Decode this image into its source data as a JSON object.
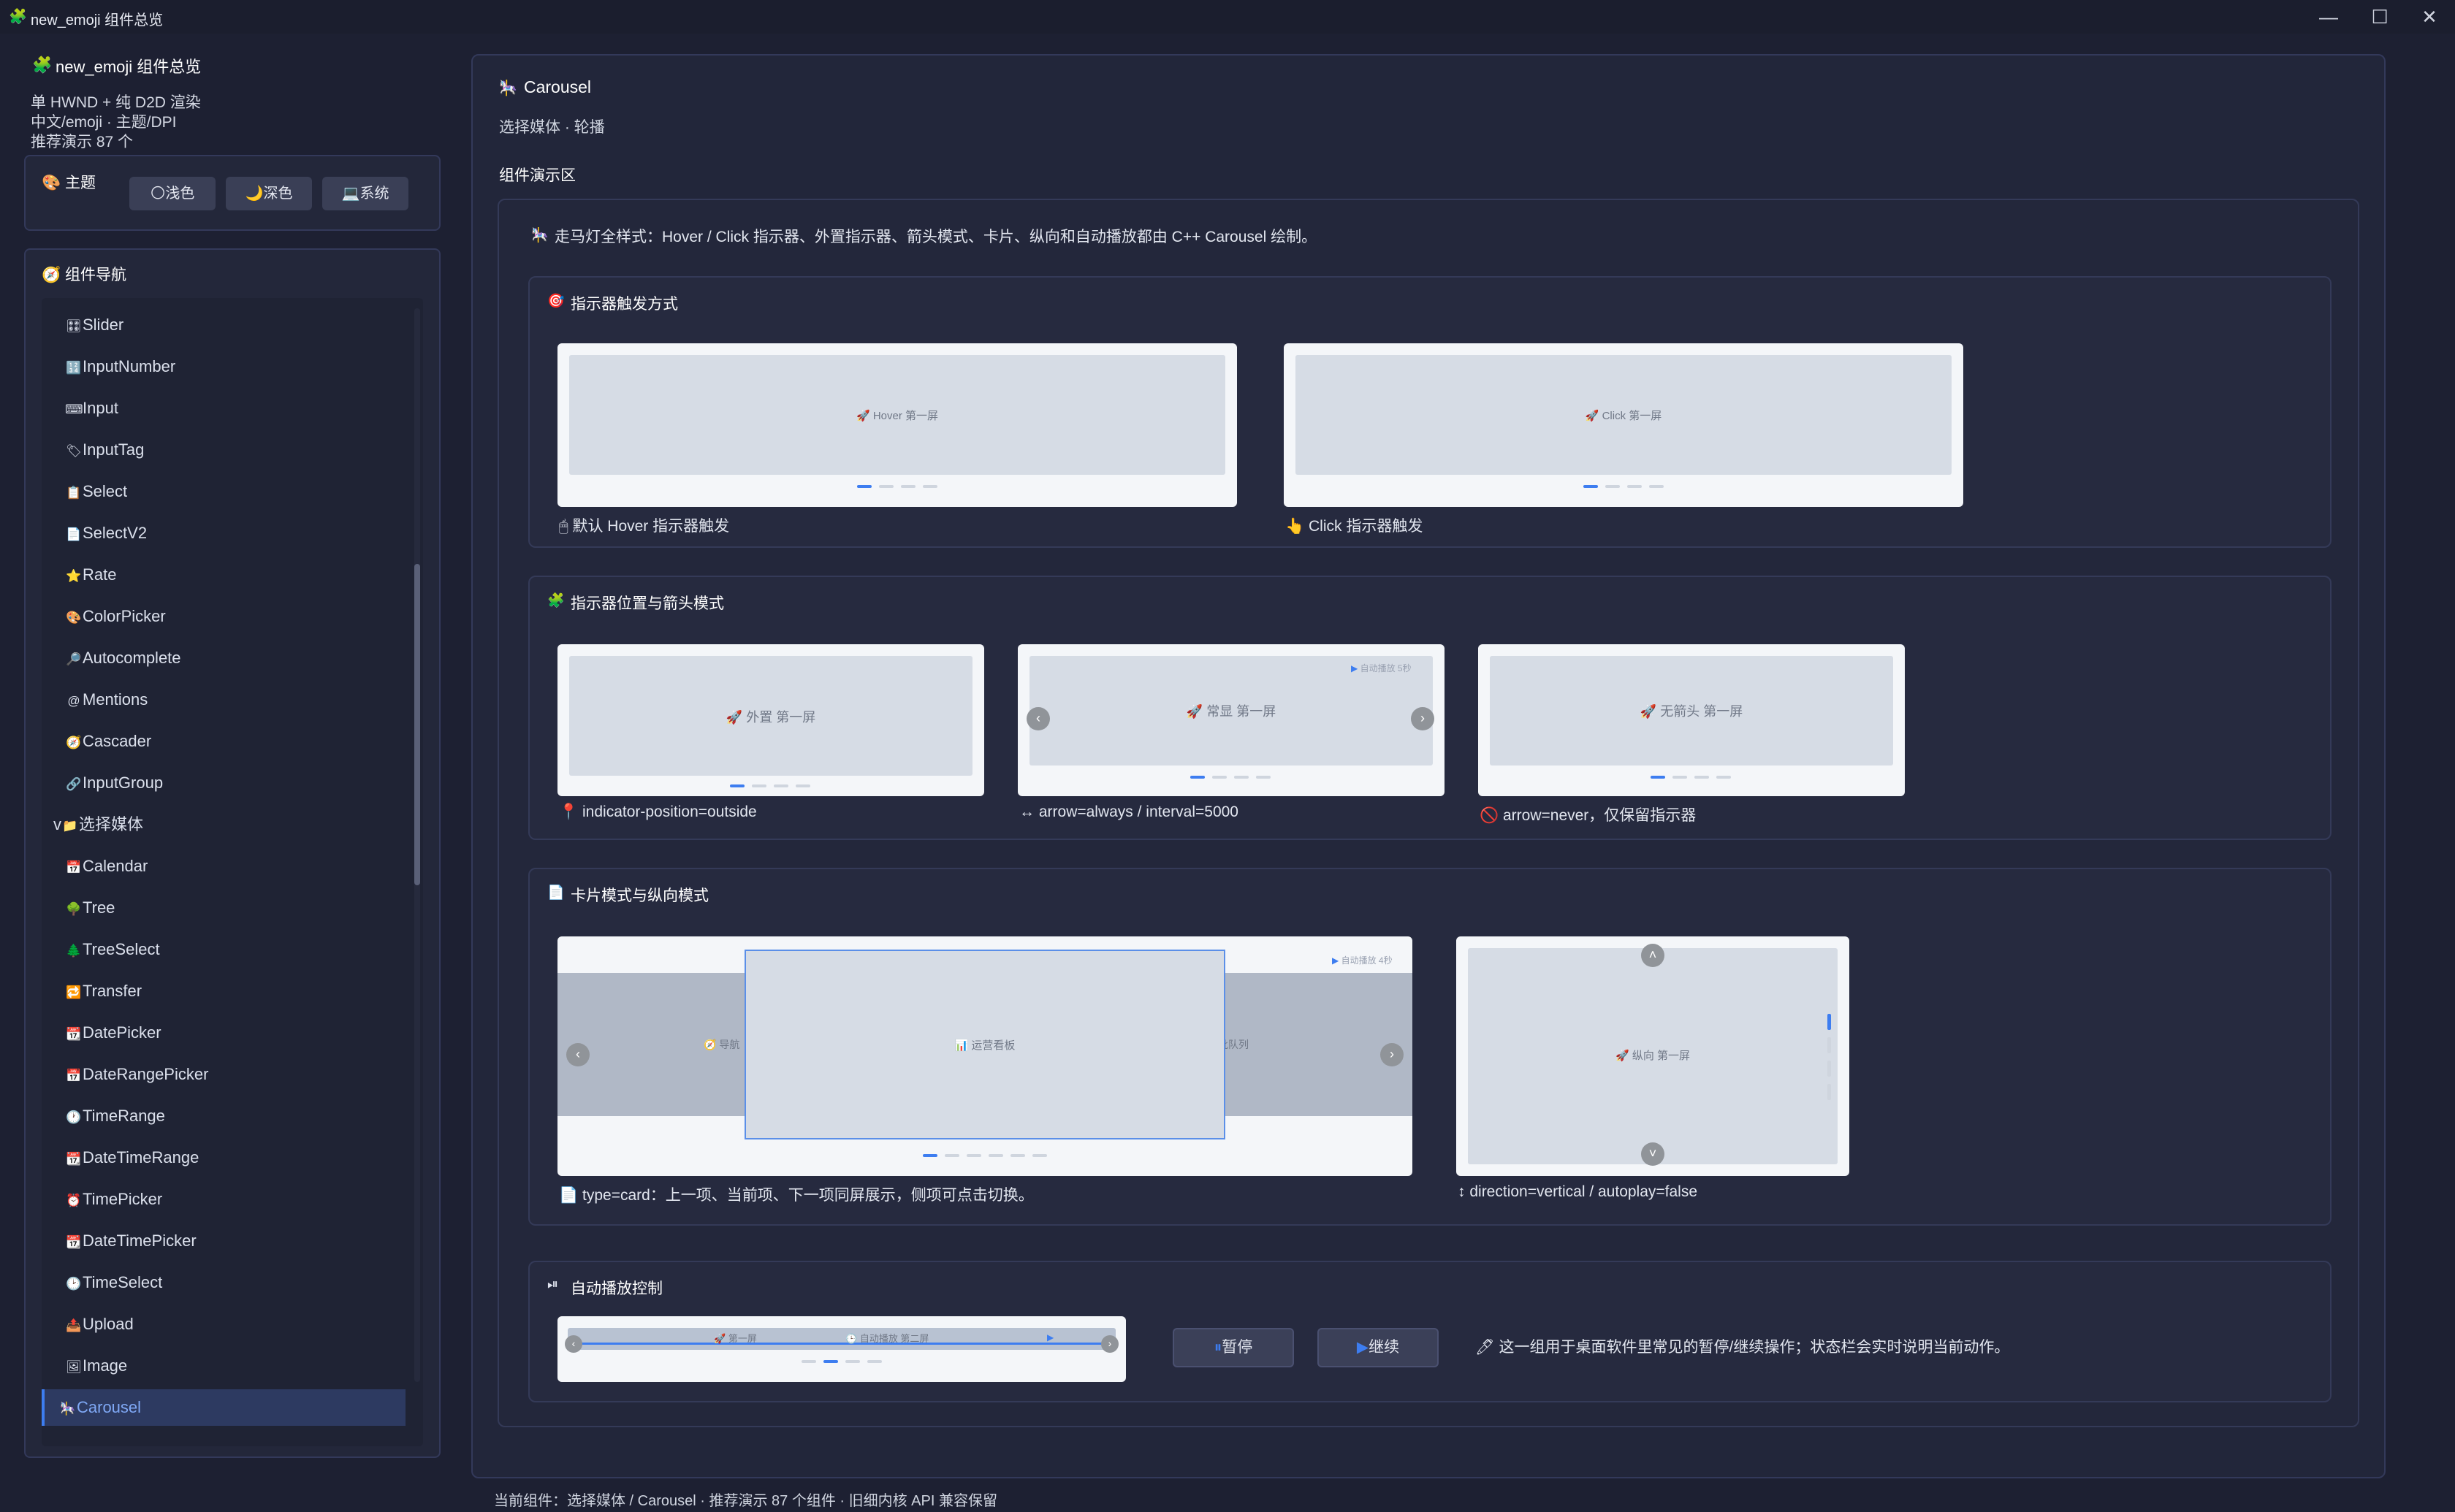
{
  "window": {
    "title": "new_emoji 组件总览",
    "controls": {
      "minimize": "—",
      "maximize": "☐",
      "close": "✕"
    }
  },
  "sidebar": {
    "app_title": "new_emoji 组件总览",
    "subtitles": [
      "单 HWND + 纯 D2D 渲染",
      "中文/emoji · 主题/DPI",
      "推荐演示 87 个"
    ],
    "theme": {
      "label": "主题",
      "buttons": [
        {
          "label": "浅色",
          "icon": "🌕"
        },
        {
          "label": "深色",
          "icon": "🌙"
        },
        {
          "label": "系统",
          "icon": "💻"
        }
      ]
    },
    "nav": {
      "title": "组件导航",
      "items": [
        {
          "label": "Slider",
          "icon": "🎛"
        },
        {
          "label": "InputNumber",
          "icon": "🔢"
        },
        {
          "label": "Input",
          "icon": "⌨"
        },
        {
          "label": "InputTag",
          "icon": "🏷"
        },
        {
          "label": "Select",
          "icon": "📋"
        },
        {
          "label": "SelectV2",
          "icon": "📄"
        },
        {
          "label": "Rate",
          "icon": "⭐"
        },
        {
          "label": "ColorPicker",
          "icon": "🎨"
        },
        {
          "label": "Autocomplete",
          "icon": "🔎"
        },
        {
          "label": "Mentions",
          "icon": "@"
        },
        {
          "label": "Cascader",
          "icon": "🧭"
        },
        {
          "label": "InputGroup",
          "icon": "🔗"
        },
        {
          "label": "选择媒体",
          "icon": "📁",
          "prefix": "v"
        },
        {
          "label": "Calendar",
          "icon": "📅"
        },
        {
          "label": "Tree",
          "icon": "🌳"
        },
        {
          "label": "TreeSelect",
          "icon": "🌲"
        },
        {
          "label": "Transfer",
          "icon": "🔁"
        },
        {
          "label": "DatePicker",
          "icon": "📆"
        },
        {
          "label": "DateRangePicker",
          "icon": "📅"
        },
        {
          "label": "TimeRange",
          "icon": "🕐"
        },
        {
          "label": "DateTimeRange",
          "icon": "📆"
        },
        {
          "label": "TimePicker",
          "icon": "⏰"
        },
        {
          "label": "DateTimePicker",
          "icon": "📆"
        },
        {
          "label": "TimeSelect",
          "icon": "🕑"
        },
        {
          "label": "Upload",
          "icon": "📤"
        },
        {
          "label": "Image",
          "icon": "🖼"
        },
        {
          "label": "Carousel",
          "icon": "🎠",
          "active": true
        }
      ]
    }
  },
  "main": {
    "title": "Carousel",
    "title_icon": "🎠",
    "subtitle": "选择媒体 · 轮播",
    "demo_label": "组件演示区",
    "intro": "走马灯全样式：Hover / Click 指示器、外置指示器、箭头模式、卡片、纵向和自动播放都由 C++ Carousel 绘制。",
    "intro_icon": "🎠",
    "sections": {
      "trigger": {
        "title": "指示器触发方式",
        "icon": "🎯",
        "demos": [
          {
            "slide": "Hover 第一屏",
            "caption": "默认 Hover 指示器触发",
            "caption_icon": "🖱"
          },
          {
            "slide": "Click 第一屏",
            "caption": "Click 指示器触发",
            "caption_icon": "👆"
          }
        ]
      },
      "position": {
        "title": "指示器位置与箭头模式",
        "icon": "🧩",
        "demos": [
          {
            "slide": "外置 第一屏",
            "caption": "indicator-position=outside",
            "caption_icon": "📍"
          },
          {
            "slide": "常显 第一屏",
            "caption": "arrow=always / interval=5000",
            "caption_icon": "↔",
            "badge": "自动播放 5秒"
          },
          {
            "slide": "无箭头 第一屏",
            "caption": "arrow=never，仅保留指示器",
            "caption_icon": "🚫"
          }
        ]
      },
      "card": {
        "title": "卡片模式与纵向模式",
        "icon": "📄",
        "card_demo": {
          "center": "运营看板",
          "left": "导航",
          "right": "审批队列",
          "badge": "自动播放 4秒",
          "caption": "type=card：上一项、当前项、下一项同屏展示，侧项可点击切换。",
          "caption_icon": "📄"
        },
        "vertical_demo": {
          "slide": "纵向 第一屏",
          "caption": "direction=vertical / autoplay=false",
          "caption_icon": "↕"
        }
      },
      "autoplay": {
        "title": "自动播放控制",
        "icon": "⏯",
        "strip_left": "第一屏",
        "strip_center": "自动播放 第二屏",
        "pause_label": "暂停",
        "resume_label": "继续",
        "note": "这一组用于桌面软件里常见的暂停/继续操作；状态栏会实时说明当前动作。",
        "note_icon": "🖊"
      }
    }
  },
  "status_bar": "当前组件：选择媒体 / Carousel · 推荐演示 87 个组件 · 旧细内核 API 兼容保留"
}
